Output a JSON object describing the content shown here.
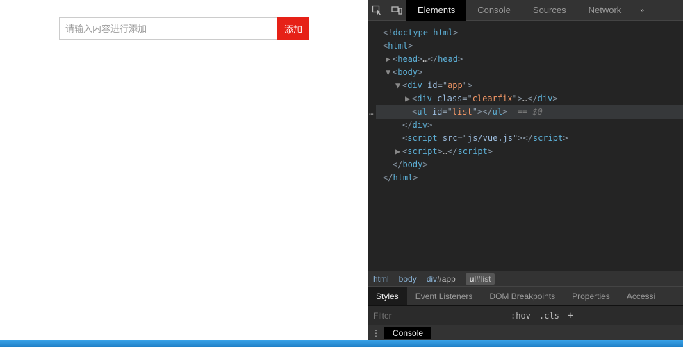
{
  "page": {
    "input_placeholder": "请输入内容进行添加",
    "add_button_label": "添加"
  },
  "devtools": {
    "tabs": [
      "Elements",
      "Console",
      "Sources",
      "Network"
    ],
    "active_tab": "Elements",
    "more_glyph": "»",
    "dom_lines": [
      {
        "indent": 0,
        "arrow": "",
        "tokens": [
          {
            "t": "pun",
            "v": "<!"
          },
          {
            "t": "tag",
            "v": "doctype html"
          },
          {
            "t": "pun",
            "v": ">"
          }
        ]
      },
      {
        "indent": 0,
        "arrow": "",
        "tokens": [
          {
            "t": "pun",
            "v": "<"
          },
          {
            "t": "tag",
            "v": "html"
          },
          {
            "t": "pun",
            "v": ">"
          }
        ]
      },
      {
        "indent": 1,
        "arrow": "▶",
        "tokens": [
          {
            "t": "pun",
            "v": "<"
          },
          {
            "t": "tag",
            "v": "head"
          },
          {
            "t": "pun",
            "v": ">"
          },
          {
            "t": "txt",
            "v": "…"
          },
          {
            "t": "pun",
            "v": "</"
          },
          {
            "t": "tag",
            "v": "head"
          },
          {
            "t": "pun",
            "v": ">"
          }
        ]
      },
      {
        "indent": 1,
        "arrow": "▼",
        "tokens": [
          {
            "t": "pun",
            "v": "<"
          },
          {
            "t": "tag",
            "v": "body"
          },
          {
            "t": "pun",
            "v": ">"
          }
        ]
      },
      {
        "indent": 2,
        "arrow": "▼",
        "tokens": [
          {
            "t": "pun",
            "v": "<"
          },
          {
            "t": "tag",
            "v": "div"
          },
          {
            "t": "txt",
            "v": " "
          },
          {
            "t": "attr-n",
            "v": "id"
          },
          {
            "t": "pun",
            "v": "=\""
          },
          {
            "t": "attr-v",
            "v": "app"
          },
          {
            "t": "pun",
            "v": "\">"
          }
        ]
      },
      {
        "indent": 3,
        "arrow": "▶",
        "tokens": [
          {
            "t": "pun",
            "v": "<"
          },
          {
            "t": "tag",
            "v": "div"
          },
          {
            "t": "txt",
            "v": " "
          },
          {
            "t": "attr-n",
            "v": "class"
          },
          {
            "t": "pun",
            "v": "=\""
          },
          {
            "t": "attr-v",
            "v": "clearfix"
          },
          {
            "t": "pun",
            "v": "\">"
          },
          {
            "t": "txt",
            "v": "…"
          },
          {
            "t": "pun",
            "v": "</"
          },
          {
            "t": "tag",
            "v": "div"
          },
          {
            "t": "pun",
            "v": ">"
          }
        ]
      },
      {
        "indent": 3,
        "arrow": "",
        "selected": true,
        "tokens": [
          {
            "t": "pun",
            "v": "<"
          },
          {
            "t": "tag",
            "v": "ul"
          },
          {
            "t": "txt",
            "v": " "
          },
          {
            "t": "attr-n",
            "v": "id"
          },
          {
            "t": "pun",
            "v": "=\""
          },
          {
            "t": "attr-v",
            "v": "list"
          },
          {
            "t": "pun",
            "v": "\">"
          },
          {
            "t": "pun",
            "v": "</"
          },
          {
            "t": "tag",
            "v": "ul"
          },
          {
            "t": "pun",
            "v": ">"
          },
          {
            "t": "eq0",
            "v": "  == $0"
          }
        ]
      },
      {
        "indent": 2,
        "arrow": "",
        "tokens": [
          {
            "t": "pun",
            "v": "</"
          },
          {
            "t": "tag",
            "v": "div"
          },
          {
            "t": "pun",
            "v": ">"
          }
        ]
      },
      {
        "indent": 2,
        "arrow": "",
        "tokens": [
          {
            "t": "pun",
            "v": "<"
          },
          {
            "t": "tag",
            "v": "script"
          },
          {
            "t": "txt",
            "v": " "
          },
          {
            "t": "attr-n",
            "v": "src"
          },
          {
            "t": "pun",
            "v": "=\""
          },
          {
            "t": "link",
            "v": "js/vue.js"
          },
          {
            "t": "pun",
            "v": "\">"
          },
          {
            "t": "pun",
            "v": "</"
          },
          {
            "t": "tag",
            "v": "script"
          },
          {
            "t": "pun",
            "v": ">"
          }
        ]
      },
      {
        "indent": 2,
        "arrow": "▶",
        "tokens": [
          {
            "t": "pun",
            "v": "<"
          },
          {
            "t": "tag",
            "v": "script"
          },
          {
            "t": "pun",
            "v": ">"
          },
          {
            "t": "txt",
            "v": "…"
          },
          {
            "t": "pun",
            "v": "</"
          },
          {
            "t": "tag",
            "v": "script"
          },
          {
            "t": "pun",
            "v": ">"
          }
        ]
      },
      {
        "indent": 1,
        "arrow": "",
        "tokens": [
          {
            "t": "pun",
            "v": "</"
          },
          {
            "t": "tag",
            "v": "body"
          },
          {
            "t": "pun",
            "v": ">"
          }
        ]
      },
      {
        "indent": 0,
        "arrow": "",
        "tokens": [
          {
            "t": "pun",
            "v": "</"
          },
          {
            "t": "tag",
            "v": "html"
          },
          {
            "t": "pun",
            "v": ">"
          }
        ]
      }
    ],
    "selected_gutter": "…",
    "breadcrumbs": [
      {
        "label": "html"
      },
      {
        "label": "body"
      },
      {
        "label": "div",
        "suffix": "#app"
      },
      {
        "label": "ul",
        "suffix": "#list",
        "selected": true
      }
    ],
    "styles_tabs": [
      "Styles",
      "Event Listeners",
      "DOM Breakpoints",
      "Properties",
      "Accessi"
    ],
    "styles_active": "Styles",
    "filter_placeholder": "Filter",
    "hov_label": ":hov",
    "cls_label": ".cls",
    "plus_glyph": "+",
    "drawer_dots": "⋮",
    "drawer_tab": "Console"
  }
}
